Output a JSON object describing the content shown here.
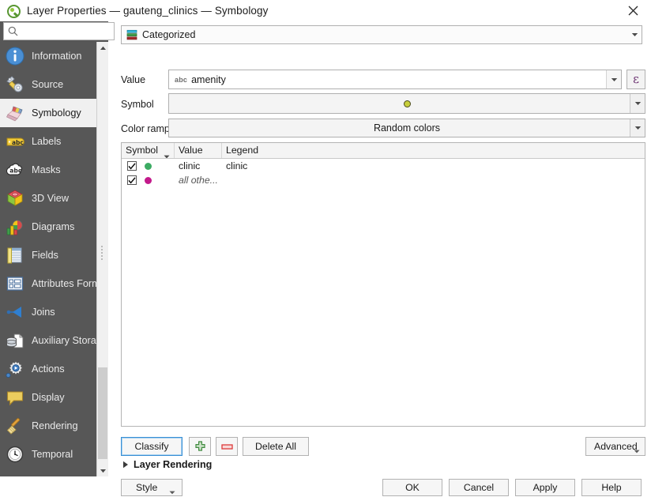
{
  "window": {
    "title": "Layer Properties — gauteng_clinics — Symbology",
    "app_icon": "qgis-logo-icon",
    "close_label": "×"
  },
  "sidebar": {
    "search": {
      "placeholder": "",
      "value": "",
      "icon": "search-icon"
    },
    "items": [
      {
        "label": "Information",
        "icon": "information-icon",
        "selected": false
      },
      {
        "label": "Source",
        "icon": "source-icon",
        "selected": false
      },
      {
        "label": "Symbology",
        "icon": "symbology-brush-icon",
        "selected": true
      },
      {
        "label": "Labels",
        "icon": "labels-tag-icon",
        "selected": false
      },
      {
        "label": "Masks",
        "icon": "masks-icon",
        "selected": false
      },
      {
        "label": "3D View",
        "icon": "cube-3d-icon",
        "selected": false
      },
      {
        "label": "Diagrams",
        "icon": "diagrams-chart-icon",
        "selected": false
      },
      {
        "label": "Fields",
        "icon": "fields-table-icon",
        "selected": false
      },
      {
        "label": "Attributes Form",
        "icon": "attributes-form-icon",
        "selected": false
      },
      {
        "label": "Joins",
        "icon": "joins-icon",
        "selected": false
      },
      {
        "label": "Auxiliary Storage",
        "icon": "auxiliary-storage-icon",
        "selected": false
      },
      {
        "label": "Actions",
        "icon": "actions-gear-icon",
        "selected": false
      },
      {
        "label": "Display",
        "icon": "display-speech-icon",
        "selected": false
      },
      {
        "label": "Rendering",
        "icon": "rendering-broom-icon",
        "selected": false
      },
      {
        "label": "Temporal",
        "icon": "temporal-clock-icon",
        "selected": false
      }
    ],
    "scrollbar": {
      "up_icon": "scroll-up-arrow-icon",
      "down_icon": "scroll-down-arrow-icon"
    }
  },
  "symbology": {
    "renderer": {
      "label": "Categorized",
      "icon": "categorized-icon"
    },
    "value": {
      "label": "Value",
      "field_type_badge": "abc",
      "selected": "amenity",
      "expression_button_glyph": "ε"
    },
    "symbol": {
      "label": "Symbol",
      "preview_color": "#c8cf3c",
      "preview_outline": "#4d4d1f"
    },
    "color_ramp": {
      "label": "Color ramp",
      "selected": "Random colors"
    },
    "table": {
      "columns": [
        "Symbol",
        "Value",
        "Legend"
      ],
      "sort_column": "Symbol",
      "rows": [
        {
          "checked": true,
          "color": "#3cab63",
          "value": "clinic",
          "legend": "clinic",
          "italic": false
        },
        {
          "checked": true,
          "color": "#c3198b",
          "value": "all othe...",
          "legend": "",
          "italic": true
        }
      ]
    }
  },
  "actions": {
    "classify": "Classify",
    "add_icon": "add-plus-icon",
    "remove_icon": "remove-minus-icon",
    "delete_all": "Delete All",
    "advanced": "Advanced"
  },
  "layer_rendering": {
    "label": "Layer Rendering",
    "expanded": false,
    "caret_icon": "collapsed-triangle-icon"
  },
  "dialog_buttons": {
    "style": "Style",
    "ok": "OK",
    "cancel": "Cancel",
    "apply": "Apply",
    "help": "Help"
  },
  "colors": {
    "sidebar_bg": "#575757",
    "sidebar_selected_bg": "#f0f0f0",
    "accent_focus": "#3a8fd4",
    "expression_purple": "#6b3070"
  }
}
